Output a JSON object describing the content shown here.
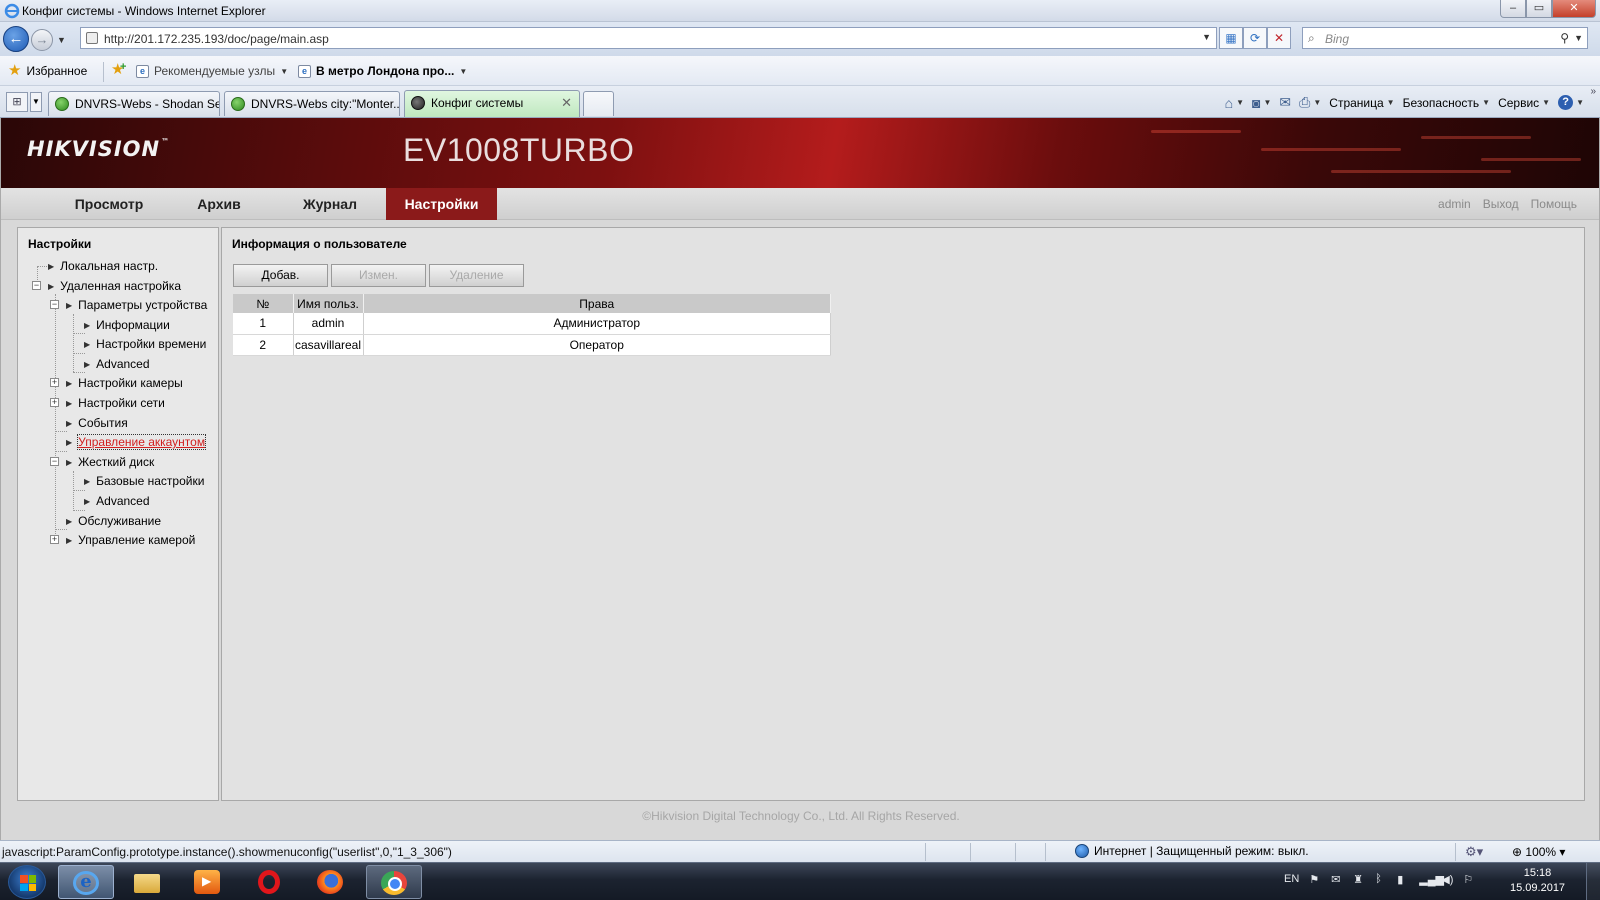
{
  "window": {
    "title": "Конфиг системы - Windows Internet Explorer",
    "controls": [
      "–",
      "▭",
      "✕"
    ]
  },
  "address": {
    "url": "http://201.172.235.193/doc/page/main.asp",
    "search_placeholder": "Bing"
  },
  "favorites_bar": {
    "favorites_label": "Избранное",
    "suggested_label": "Рекомендуемые узлы",
    "metro_label": "В метро Лондона про..."
  },
  "tabs": [
    {
      "label": "DNVRS-Webs - Shodan Se..."
    },
    {
      "label": "DNVRS-Webs city:\"Monter..."
    },
    {
      "label": "Конфиг системы",
      "active": true
    }
  ],
  "command_bar": {
    "page": "Страница",
    "safety": "Безопасность",
    "service": "Сервис"
  },
  "device": {
    "brand": "HIKVISION",
    "model": "EV1008TURBO"
  },
  "main_menu": {
    "items": [
      "Просмотр",
      "Архив",
      "Журнал",
      "Настройки"
    ],
    "active_index": 3,
    "user": "admin",
    "logout": "Выход",
    "help": "Помощь"
  },
  "sidebar": {
    "title": "Настройки",
    "tree": [
      {
        "label": "Локальная настр."
      },
      {
        "label": "Удаленная настройка"
      },
      {
        "label": "Параметры устройства"
      },
      {
        "label": "Информации"
      },
      {
        "label": "Настройки времени"
      },
      {
        "label": "Advanced"
      },
      {
        "label": "Настройки камеры"
      },
      {
        "label": "Настройки сети"
      },
      {
        "label": "События"
      },
      {
        "label": "Управление аккаунтом",
        "selected": true
      },
      {
        "label": "Жесткий диск"
      },
      {
        "label": "Базовые настройки"
      },
      {
        "label": "Advanced"
      },
      {
        "label": "Обслуживание"
      },
      {
        "label": "Управление камерой"
      }
    ]
  },
  "main": {
    "title": "Информация о пользователе",
    "buttons": {
      "add": "Добав.",
      "edit": "Измен.",
      "delete": "Удаление"
    },
    "table": {
      "headers": [
        "№",
        "Имя польз.",
        "Права"
      ],
      "rows": [
        {
          "no": "1",
          "user": "admin",
          "rights": "Администратор"
        },
        {
          "no": "2",
          "user": "casavillareal",
          "rights": "Оператор"
        }
      ]
    }
  },
  "footer": {
    "copyright": "©Hikvision Digital Technology Co., Ltd. All Rights Reserved."
  },
  "status_bar": {
    "text": "javascript:ParamConfig.prototype.instance().showmenuconfig(\"userlist\",0,\"1_3_306\")",
    "zone": "Интернет | Защищенный режим: выкл.",
    "zoom": "100%"
  },
  "taskbar": {
    "lang": "EN",
    "time": "15:18",
    "date": "15.09.2017"
  },
  "colors": {
    "accent_red": "#8b1a1a",
    "selected_link": "#d21f1f"
  }
}
